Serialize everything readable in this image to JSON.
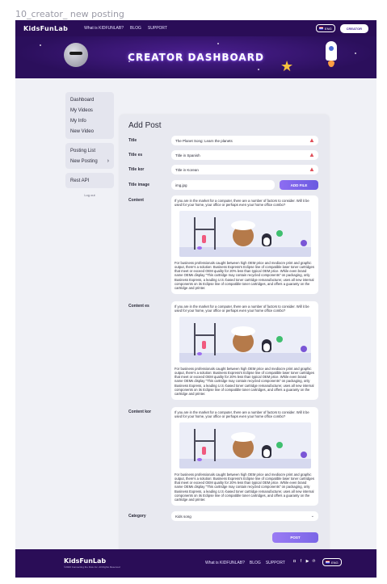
{
  "frame_label": "10_creator_ new posting",
  "header": {
    "logo": "KidsFunLab",
    "nav": [
      "What is KIDFUNLAB?",
      "BLOG",
      "SUPPORT"
    ],
    "lang": "ENG",
    "creator_button": "CREATOR"
  },
  "banner": {
    "title": "CREATOR DASHBOARD"
  },
  "sidebar": {
    "group1": [
      "Dashboard",
      "My Videos",
      "My Info",
      "New Video"
    ],
    "group2": [
      "Posting List",
      "New Posting"
    ],
    "group3": [
      "Rest API"
    ],
    "logout": "Log out"
  },
  "form": {
    "title": "Add Post",
    "labels": {
      "title": "Title",
      "title_es": "Title es",
      "title_kor": "Title kor",
      "title_image": "Title image",
      "content": "Content",
      "content_es": "Content es",
      "content_kor": "Content kor",
      "category": "Category"
    },
    "values": {
      "title": "The Planet Song: Learn the planets",
      "title_es": "Title in Spanish",
      "title_kor": "Title in Korean",
      "title_image": "img.jpg"
    },
    "add_file": "ADD FILE",
    "content_text_1": "If you are in the market for a computer, there are a number of factors to consider. Will it be used for your home, your office or perhaps even your home office combo?",
    "content_text_2": "For business professionals caught between high OEM price and mediocre print and graphic output, there's a solution: Business Express's Eclipse line of compatible laser toner cartridges that meet or exceed OEM quality for 20% less than typical OEM price. While even brand name OEMs display \"This cartridge may contain recycled components\" on packaging, only Business Express, a leading U.S.-based toner cartridge remanufacturer, uses all new internal components on its Eclipse line of compatible toner cartridges, and offers a guaranty on the cartridge and printer.",
    "category_value": "Kids song",
    "post_button": "POST"
  },
  "footer": {
    "logo": "KidsFunLab",
    "copyright": "©2020 Connecting the Dots Inc. All Rights Reserved",
    "nav": [
      "What is KIDFUNLAB?",
      "BLOG",
      "SUPPORT"
    ],
    "lang": "ENG"
  }
}
